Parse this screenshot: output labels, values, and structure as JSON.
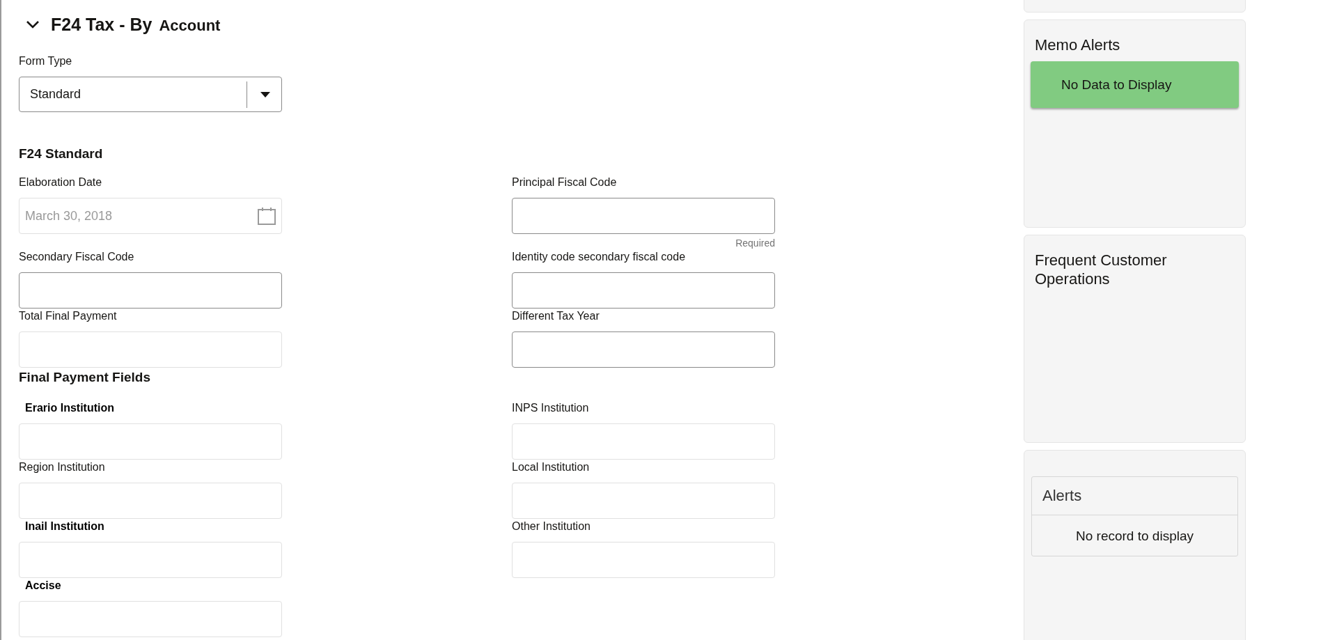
{
  "header": {
    "expanded": true,
    "title": "F24 Tax - By",
    "title_suffix": "Account"
  },
  "form_type": {
    "label": "Form Type",
    "value": "Standard"
  },
  "sections": [
    {
      "heading": "F24 Standard",
      "rows": [
        [
          {
            "label": "Elaboration Date",
            "value": "March 30, 2018",
            "disabled": true,
            "strong_label": false,
            "kind": "date"
          },
          {
            "label": "Principal Fiscal Code",
            "disabled": false,
            "strong_label": false,
            "kind": "text",
            "hint": "Required"
          }
        ],
        [
          {
            "label": "Secondary Fiscal Code",
            "disabled": false,
            "strong_label": false,
            "kind": "text"
          },
          {
            "label": "Identity code secondary fiscal code",
            "disabled": false,
            "strong_label": false,
            "kind": "text"
          }
        ],
        [
          {
            "label": "Total Final Payment",
            "disabled": true,
            "strong_label": false,
            "kind": "text"
          },
          {
            "label": "Different Tax Year",
            "disabled": false,
            "strong_label": false,
            "kind": "text"
          }
        ]
      ]
    },
    {
      "heading": "Final Payment Fields",
      "rows": [
        [
          {
            "label": "Erario Institution",
            "disabled": true,
            "strong_label": true,
            "kind": "text"
          },
          {
            "label": "INPS Institution",
            "disabled": true,
            "strong_label": false,
            "kind": "text"
          }
        ],
        [
          {
            "label": "Region Institution",
            "disabled": true,
            "strong_label": false,
            "kind": "text"
          },
          {
            "label": "Local Institution",
            "disabled": true,
            "strong_label": false,
            "kind": "text"
          }
        ],
        [
          {
            "label": "Inail Institution",
            "disabled": true,
            "strong_label": true,
            "kind": "text"
          },
          {
            "label": "Other Institution",
            "disabled": true,
            "strong_label": false,
            "kind": "text"
          }
        ],
        [
          {
            "label": "Accise",
            "disabled": true,
            "strong_label": true,
            "kind": "text"
          }
        ]
      ]
    }
  ],
  "sidebar": {
    "memo_alerts": {
      "title": "Memo Alerts",
      "message": "No Data to Display"
    },
    "frequent_operations": {
      "title": "Frequent Customer Operations"
    },
    "alerts": {
      "title": "Alerts",
      "message": "No record to display"
    }
  }
}
